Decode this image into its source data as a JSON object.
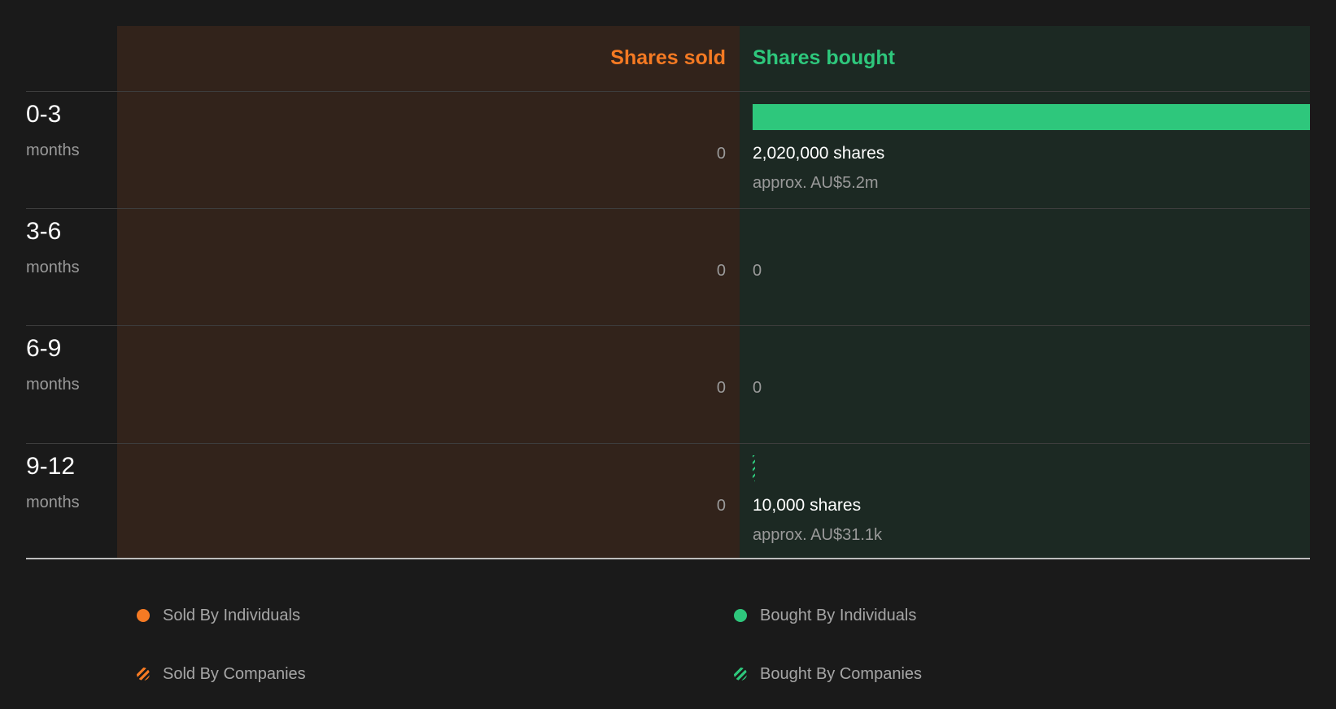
{
  "chart_data": {
    "type": "bar",
    "headers": {
      "sold": "Shares sold",
      "bought": "Shares bought"
    },
    "rows": [
      {
        "range": "0-3",
        "unit": "months",
        "sold": "0",
        "bought_shares": "2,020,000 shares",
        "bought_approx": "approx. AU$5.2m",
        "bought_value": 2020000,
        "bought_type": "individual"
      },
      {
        "range": "3-6",
        "unit": "months",
        "sold": "0",
        "bought": "0",
        "bought_value": 0
      },
      {
        "range": "6-9",
        "unit": "months",
        "sold": "0",
        "bought": "0",
        "bought_value": 0
      },
      {
        "range": "9-12",
        "unit": "months",
        "sold": "0",
        "bought_shares": "10,000 shares",
        "bought_approx": "approx. AU$31.1k",
        "bought_value": 10000,
        "bought_type": "company"
      }
    ],
    "max_value": 2020000,
    "legend": [
      {
        "label": "Sold By Individuals",
        "color": "#f57a23",
        "style": "solid"
      },
      {
        "label": "Bought By Individuals",
        "color": "#2ec77c",
        "style": "solid"
      },
      {
        "label": "Sold By Companies",
        "color": "#f57a23",
        "style": "hatched"
      },
      {
        "label": "Bought By Companies",
        "color": "#2ec77c",
        "style": "hatched"
      }
    ],
    "colors": {
      "sold": "#f57a23",
      "bought": "#2ec77c"
    }
  }
}
